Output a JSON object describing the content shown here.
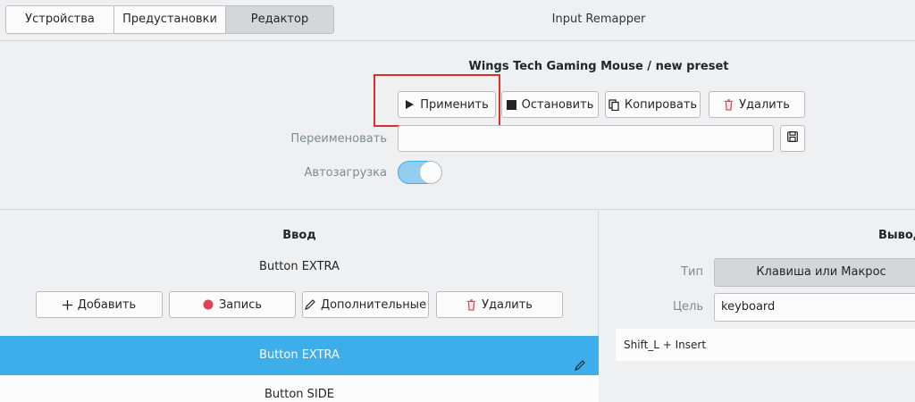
{
  "header": {
    "tabs": [
      "Устройства",
      "Предустановки",
      "Редактор"
    ],
    "active_tab": "Редактор",
    "app_title": "Input Remapper"
  },
  "preset": {
    "device_name": "Wings Tech Gaming Mouse",
    "separator": "/",
    "preset_name": "new preset",
    "actions": {
      "apply": "Применить",
      "stop": "Остановить",
      "copy": "Копировать",
      "delete": "Удалить"
    },
    "rename_label": "Переименовать",
    "rename_value": "",
    "autoload_label": "Автозагрузка",
    "autoload_on": true
  },
  "input": {
    "title": "Ввод",
    "current_input": "Button EXTRA",
    "buttons": {
      "add": "Добавить",
      "record": "Запись",
      "advanced": "Дополнительные",
      "delete": "Удалить"
    },
    "mappings": [
      "Button EXTRA",
      "Button SIDE"
    ],
    "selected_mapping": "Button EXTRA"
  },
  "output": {
    "title": "Вывод",
    "type_label": "Тип",
    "type_value": "Клавиша или Макрос",
    "target_label": "Цель",
    "target_value": "keyboard",
    "macro": "Shift_L + Insert"
  },
  "colors": {
    "accent": "#3daee9",
    "highlight_box": "#d9302b",
    "record_dot": "#da4453",
    "delete_icon": "#da4453"
  }
}
